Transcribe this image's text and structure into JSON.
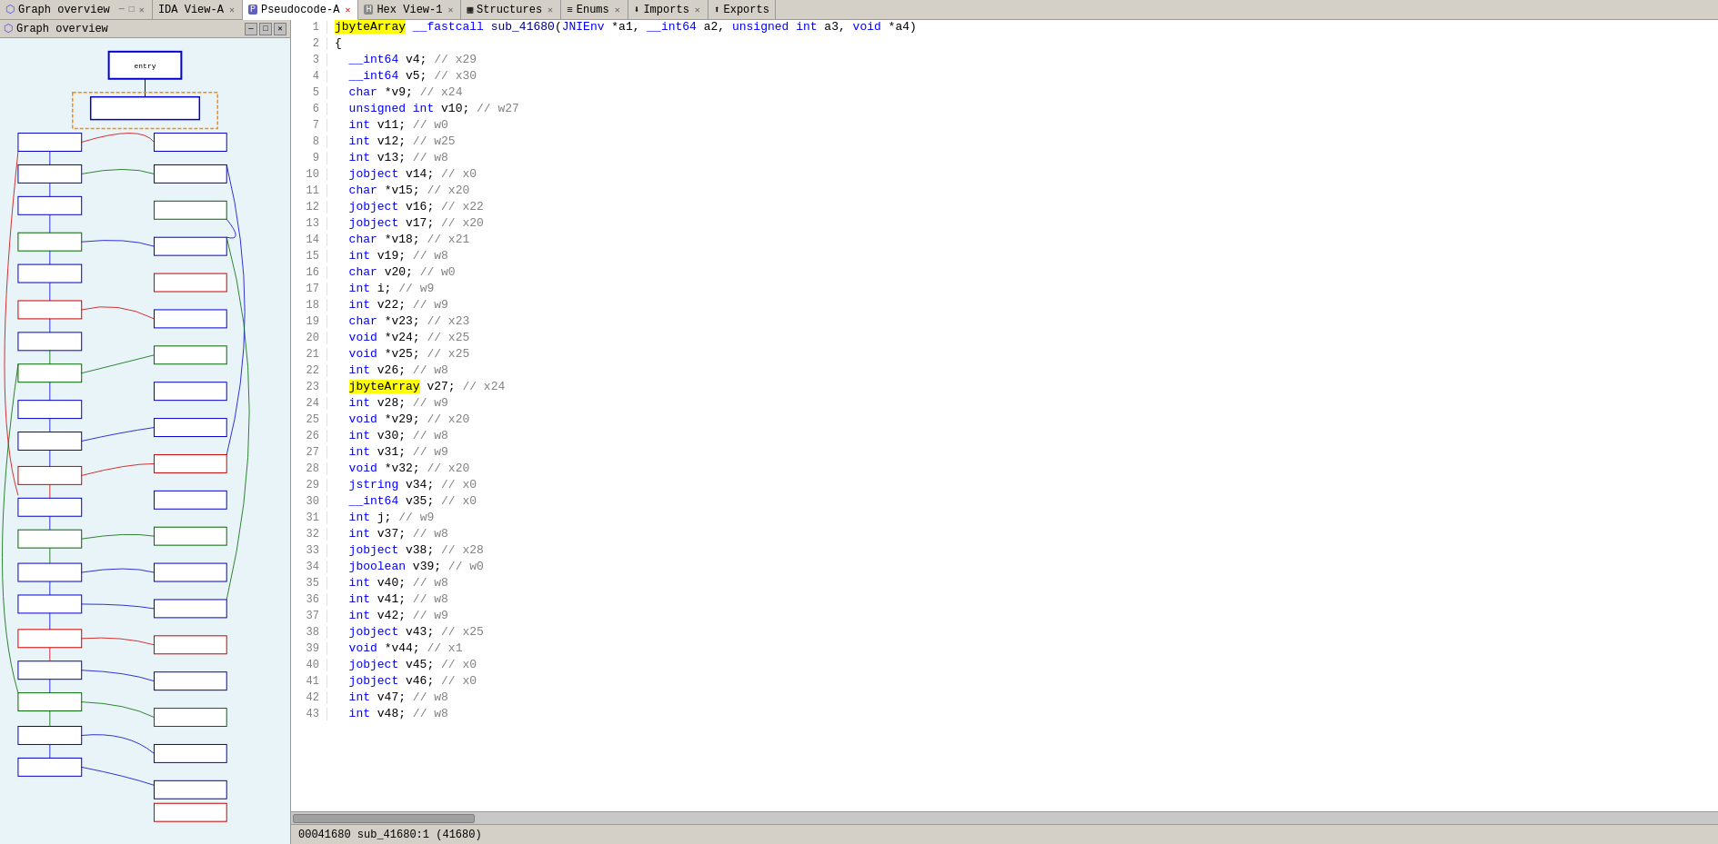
{
  "tabs": [
    {
      "id": "graph",
      "label": "Graph overview",
      "icon": "graph",
      "active": false,
      "closable": true
    },
    {
      "id": "ida-view",
      "label": "IDA View-A",
      "icon": "ida",
      "active": false,
      "closable": true
    },
    {
      "id": "pseudocode",
      "label": "Pseudocode-A",
      "icon": "pseudo",
      "active": true,
      "closable": true
    },
    {
      "id": "hex-view",
      "label": "Hex View-1",
      "icon": "hex",
      "active": false,
      "closable": true
    },
    {
      "id": "structures",
      "label": "Structures",
      "icon": "struct",
      "active": false,
      "closable": true
    },
    {
      "id": "enums",
      "label": "Enums",
      "icon": "enum",
      "active": false,
      "closable": true
    },
    {
      "id": "imports",
      "label": "Imports",
      "icon": "imports",
      "active": false,
      "closable": true
    },
    {
      "id": "exports",
      "label": "Exports",
      "icon": "exports",
      "active": false,
      "closable": false
    }
  ],
  "graph_panel": {
    "title": "Graph overview",
    "buttons": [
      "□",
      "─",
      "✕"
    ]
  },
  "code": {
    "lines": [
      {
        "num": 1,
        "text": "jbyteArray __fastcall sub_41680(JNIEnv *a1, __int64 a2, unsigned int a3, void *a4)",
        "highlight_word": "jbyteArray"
      },
      {
        "num": 2,
        "text": "{"
      },
      {
        "num": 3,
        "text": "  __int64 v4; // x29"
      },
      {
        "num": 4,
        "text": "  __int64 v5; // x30"
      },
      {
        "num": 5,
        "text": "  char *v9; // x24"
      },
      {
        "num": 6,
        "text": "  unsigned int v10; // w27"
      },
      {
        "num": 7,
        "text": "  int v11; // w0"
      },
      {
        "num": 8,
        "text": "  int v12; // w25"
      },
      {
        "num": 9,
        "text": "  int v13; // w8"
      },
      {
        "num": 10,
        "text": "  jobject v14; // x0"
      },
      {
        "num": 11,
        "text": "  char *v15; // x20"
      },
      {
        "num": 12,
        "text": "  jobject v16; // x22"
      },
      {
        "num": 13,
        "text": "  jobject v17; // x20"
      },
      {
        "num": 14,
        "text": "  char *v18; // x21"
      },
      {
        "num": 15,
        "text": "  int v19; // w8"
      },
      {
        "num": 16,
        "text": "  char v20; // w0"
      },
      {
        "num": 17,
        "text": "  int i; // w9"
      },
      {
        "num": 18,
        "text": "  int v22; // w9"
      },
      {
        "num": 19,
        "text": "  char *v23; // x23"
      },
      {
        "num": 20,
        "text": "  void *v24; // x25"
      },
      {
        "num": 21,
        "text": "  void *v25; // x25"
      },
      {
        "num": 22,
        "text": "  int v26; // w8"
      },
      {
        "num": 23,
        "text": "  jbyteArray v27; // x24",
        "highlight_word": "jbyteArray"
      },
      {
        "num": 24,
        "text": "  int v28; // w9"
      },
      {
        "num": 25,
        "text": "  void *v29; // x20"
      },
      {
        "num": 26,
        "text": "  int v30; // w8"
      },
      {
        "num": 27,
        "text": "  int v31; // w9"
      },
      {
        "num": 28,
        "text": "  void *v32; // x20"
      },
      {
        "num": 29,
        "text": "  jstring v34; // x0"
      },
      {
        "num": 30,
        "text": "  __int64 v35; // x0"
      },
      {
        "num": 31,
        "text": "  int j; // w9"
      },
      {
        "num": 32,
        "text": "  int v37; // w8"
      },
      {
        "num": 33,
        "text": "  jobject v38; // x28"
      },
      {
        "num": 34,
        "text": "  jboolean v39; // w0"
      },
      {
        "num": 35,
        "text": "  int v40; // w8"
      },
      {
        "num": 36,
        "text": "  int v41; // w8"
      },
      {
        "num": 37,
        "text": "  int v42; // w9"
      },
      {
        "num": 38,
        "text": "  jobject v43; // x25"
      },
      {
        "num": 39,
        "text": "  void *v44; // x1"
      },
      {
        "num": 40,
        "text": "  jobject v45; // x0"
      },
      {
        "num": 41,
        "text": "  jobject v46; // x0"
      },
      {
        "num": 42,
        "text": "  int v47; // w8"
      },
      {
        "num": 43,
        "text": "  int v48; // w8"
      }
    ]
  },
  "status_bar": {
    "address": "00041680",
    "label": "sub_41680:1 (41680)"
  }
}
